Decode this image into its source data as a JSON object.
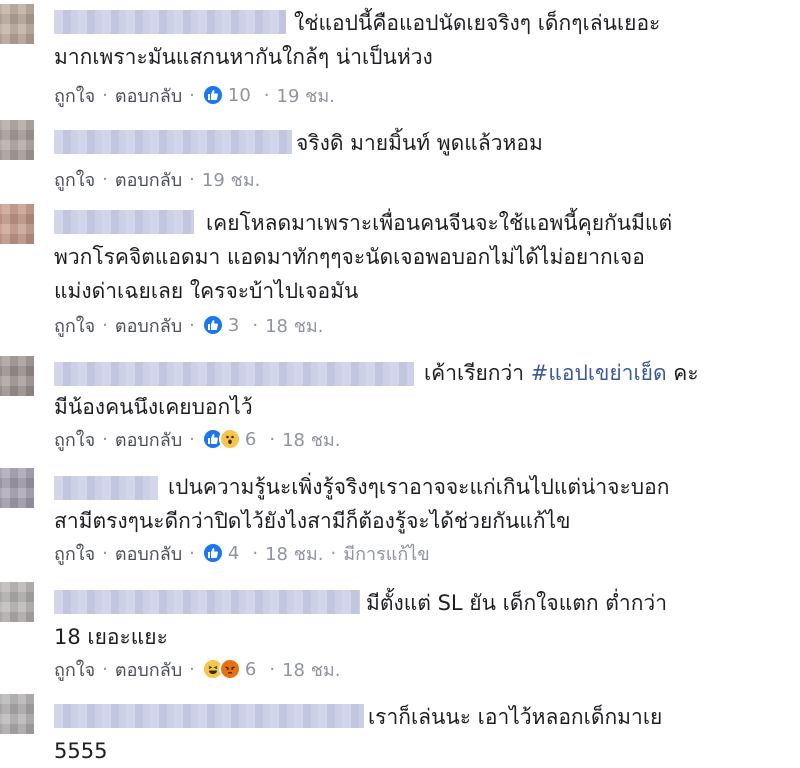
{
  "labels": {
    "like": "ถูกใจ",
    "reply": "ตอบกลับ",
    "separator": "·"
  },
  "comments": [
    {
      "text_line1": "ใช่แอปนี้คือแอปนัดเยจริงๆ เด็กๆเล่นเยอะ",
      "text_line2": "มากเพราะมันแสกนหากันใกล้ๆ น่าเป็นห่วง",
      "reactions": [
        "like-icon"
      ],
      "reaction_count": "10",
      "time": "19 ชม."
    },
    {
      "text_line1": "จริงดิ มายมิ้นท์ พูดแล้วหอม",
      "time": "19 ชม."
    },
    {
      "text_line1": "เคยโหลดมาเพราะเพื่อนคนจีนจะใช้แอพนี้คุยกันมีแต่",
      "text_line2": "พวกโรคจิตแอดมา แอดมาทักๆๆจะนัดเจอพอบอกไม่ได้ไม่อยากเจอ",
      "text_line3": "แม่งด่าเฉยเลย ใครจะบ้าไปเจอมัน",
      "reactions": [
        "like-icon"
      ],
      "reaction_count": "3",
      "time": "18 ชม."
    },
    {
      "text_line1_prefix": "เค้าเรียกว่า ",
      "hashtag": "#แอปเขย่าเย็ด",
      "text_line1_suffix": " คะ",
      "text_line2": "มีน้องคนนึงเคยบอกไว้",
      "reactions": [
        "like-icon",
        "wow-icon"
      ],
      "reaction_count": "6",
      "time": "18 ชม."
    },
    {
      "text_line1": "เปนความรู้นะเพิ่งรู้จริงๆเราอาจจะแก่เกินไปแต่น่าจะบอก",
      "text_line2": "สามีตรงๆนะดีกว่าปิดไว้ยังไงสามีก็ต้องรู้จะได้ช่วยกันแก้ไข",
      "reactions": [
        "like-icon"
      ],
      "reaction_count": "4",
      "time": "18 ชม.",
      "edited": "มีการแก้ไข"
    },
    {
      "text_line1": "มีตั้งแต่ SL ยัน เด็กใจแตก ต่ำกว่า",
      "text_line2": "18 เยอะแยะ",
      "reactions": [
        "haha-icon",
        "angry-icon"
      ],
      "reaction_count": "6",
      "time": "18 ชม."
    },
    {
      "text_line1": "เราก็เล่นนะ เอาไว้หลอกเด็กมาเย",
      "text_line2": "5555"
    }
  ],
  "colors": {
    "text": "#1c1e21",
    "meta": "#90949c",
    "hashtag": "#385898",
    "like": "#1877f2"
  }
}
